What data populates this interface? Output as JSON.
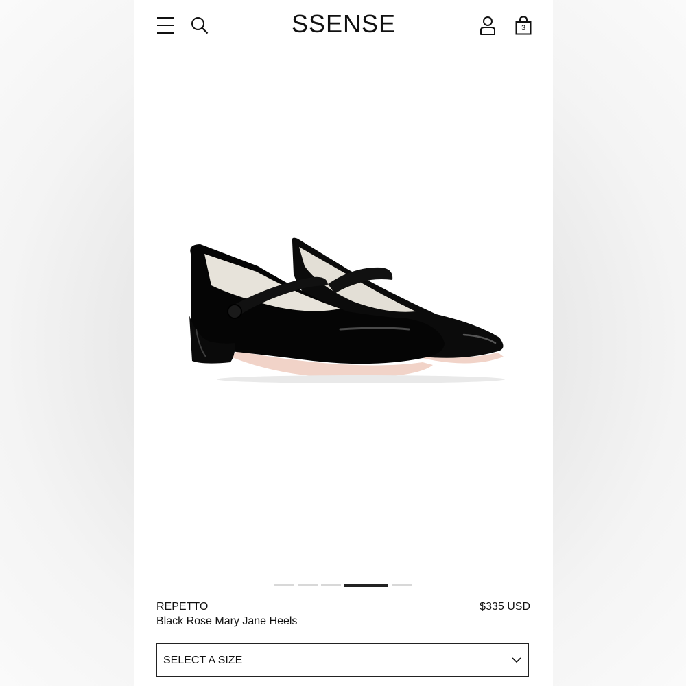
{
  "header": {
    "logo": "SSENSE",
    "menu_icon": "hamburger-menu-icon",
    "search_icon": "search-icon",
    "account_icon": "user-account-icon",
    "bag_icon": "shopping-bag-icon",
    "bag_count": "3"
  },
  "gallery": {
    "image_count": 5,
    "active_index": 3
  },
  "product": {
    "brand": "REPETTO",
    "name": "Black Rose Mary Jane Heels",
    "price": "$335 USD"
  },
  "size_selector": {
    "label": "SELECT A SIZE",
    "icon": "chevron-down-icon"
  },
  "colors": {
    "text": "#111111",
    "background": "#ffffff",
    "indicator_active": "#222222",
    "indicator_inactive": "#d8d8d8"
  }
}
